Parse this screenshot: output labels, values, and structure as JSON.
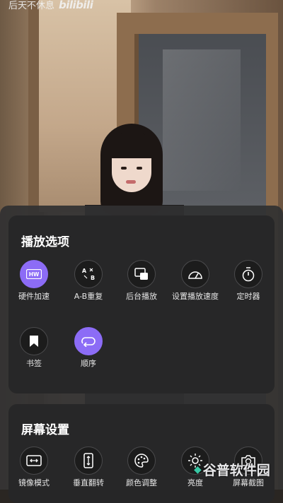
{
  "watermark": {
    "text": "后天不休息",
    "brand": "bilibili"
  },
  "play_options": {
    "title": "播放选项",
    "items": [
      {
        "label": "硬件加速",
        "icon": "hw-icon",
        "active": true
      },
      {
        "label": "A-B重复",
        "icon": "ab-repeat-icon",
        "active": false
      },
      {
        "label": "后台播放",
        "icon": "background-play-icon",
        "active": false
      },
      {
        "label": "设置播放速度",
        "icon": "speedometer-icon",
        "active": false
      },
      {
        "label": "定时器",
        "icon": "timer-icon",
        "active": false
      },
      {
        "label": "书签",
        "icon": "bookmark-icon",
        "active": false
      },
      {
        "label": "顺序",
        "icon": "loop-icon",
        "active": true
      }
    ]
  },
  "screen_settings": {
    "title": "屏幕设置",
    "items": [
      {
        "label": "镜像模式",
        "icon": "mirror-icon"
      },
      {
        "label": "垂直翻转",
        "icon": "vertical-flip-icon"
      },
      {
        "label": "颜色调整",
        "icon": "palette-icon"
      },
      {
        "label": "亮度",
        "icon": "brightness-icon"
      },
      {
        "label": "屏幕截图",
        "icon": "screenshot-icon"
      }
    ]
  },
  "logo": {
    "text": "谷普软件园"
  },
  "colors": {
    "accent": "#8c6cf6",
    "panel": "#303032",
    "card": "#262628",
    "logo_accent": "#38c7a4"
  }
}
